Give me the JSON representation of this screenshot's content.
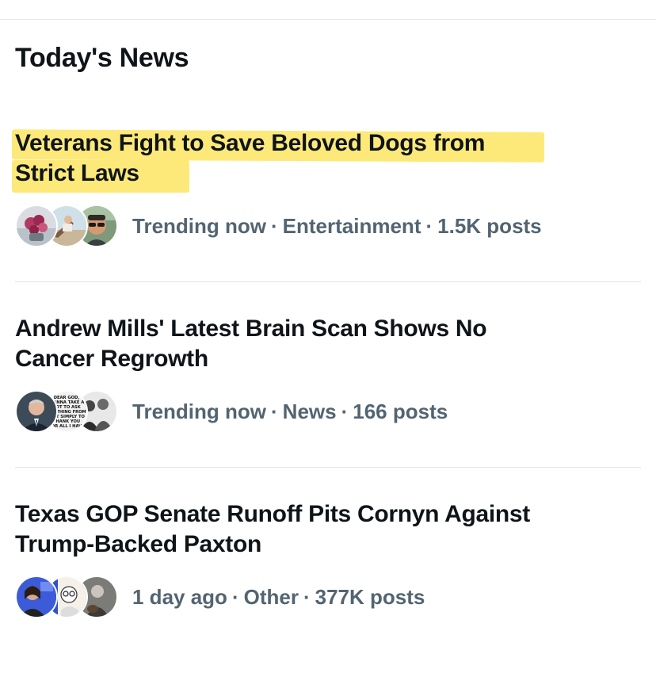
{
  "section": {
    "title": "Today's News"
  },
  "items": [
    {
      "headline_line1": "Veterans Fight to Save Beloved Dogs from",
      "headline_line2": "Strict Laws",
      "highlighted": true,
      "time": "Trending now",
      "category": "Entertainment",
      "posts": "1.5K posts",
      "avatars": [
        "flowers-avatar",
        "beach-chair-avatar",
        "man-with-sunglasses-avatar"
      ]
    },
    {
      "headline_line1": "Andrew Mills' Latest Brain Scan Shows No",
      "headline_line2": "Cancer Regrowth",
      "highlighted": false,
      "time": "Trending now",
      "category": "News",
      "posts": "166 posts",
      "avatars": [
        "man-in-suit-avatar",
        "text-quote-avatar",
        "group-photo-avatar"
      ],
      "avatar_quote_text": "DEAR GOD, WANNA TAKE A... NOT TO ASK ANYTHING FROM... JUST SIMPLY TO THANK YOU FOR ALL I HAVE"
    },
    {
      "headline_line1": "Texas GOP Senate Runoff Pits Cornyn Against",
      "headline_line2": "Trump-Backed Paxton",
      "highlighted": false,
      "time": "1 day ago",
      "category": "Other",
      "posts": "377K posts",
      "avatars": [
        "woman-presenter-avatar",
        "cartoon-avatar",
        "dog-avatar"
      ]
    }
  ],
  "separator": "·",
  "colors": {
    "text_primary": "#0f1419",
    "text_secondary": "#536471",
    "highlight": "#fde45b",
    "divider": "#e1e4e8"
  }
}
